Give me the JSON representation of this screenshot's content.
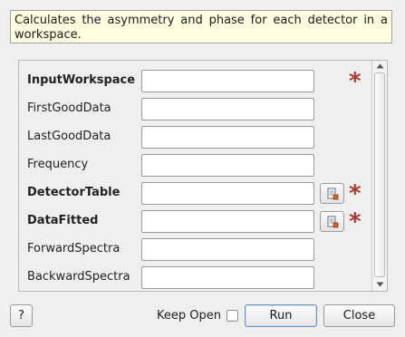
{
  "description": "Calculates the asymmetry and phase for each detector in a workspace.",
  "properties": [
    {
      "label": "InputWorkspace",
      "value": "",
      "mandatory": true,
      "browse": false
    },
    {
      "label": "FirstGoodData",
      "value": "",
      "mandatory": false,
      "browse": false
    },
    {
      "label": "LastGoodData",
      "value": "",
      "mandatory": false,
      "browse": false
    },
    {
      "label": "Frequency",
      "value": "",
      "mandatory": false,
      "browse": false
    },
    {
      "label": "DetectorTable",
      "value": "",
      "mandatory": true,
      "browse": true
    },
    {
      "label": "DataFitted",
      "value": "",
      "mandatory": true,
      "browse": true
    },
    {
      "label": "ForwardSpectra",
      "value": "",
      "mandatory": false,
      "browse": false
    },
    {
      "label": "BackwardSpectra",
      "value": "",
      "mandatory": false,
      "browse": false
    }
  ],
  "mandatory_marker": "*",
  "buttons": {
    "help": "?",
    "keep_open": "Keep Open",
    "keep_open_checked": false,
    "run": "Run",
    "close": "Close"
  },
  "colors": {
    "mandatory": "#a93a32",
    "description_bg": "#ffffe1",
    "window_bg": "#efefef"
  }
}
